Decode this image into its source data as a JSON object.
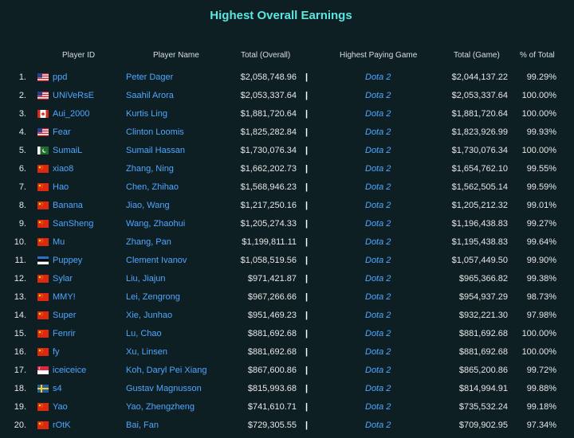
{
  "title": "Highest Overall Earnings",
  "headers": {
    "player_id": "Player ID",
    "player_name": "Player Name",
    "total_overall": "Total (Overall)",
    "highest_paying_game": "Highest Paying Game",
    "total_game": "Total (Game)",
    "pct_total": "% of Total"
  },
  "separator": "|",
  "colors": {
    "background": "#0e1f24",
    "title": "#5ce6e0",
    "link": "#4fa6ff",
    "text": "#e6e6e6"
  },
  "rows": [
    {
      "rank": "1.",
      "flag": "us",
      "id": "ppd",
      "name": "Peter Dager",
      "total": "$2,058,748.96",
      "game": "Dota 2",
      "game_total": "$2,044,137.22",
      "pct": "99.29%"
    },
    {
      "rank": "2.",
      "flag": "us",
      "id": "UNiVeRsE",
      "name": "Saahil Arora",
      "total": "$2,053,337.64",
      "game": "Dota 2",
      "game_total": "$2,053,337.64",
      "pct": "100.00%"
    },
    {
      "rank": "3.",
      "flag": "ca",
      "id": "Aui_2000",
      "name": "Kurtis Ling",
      "total": "$1,881,720.64",
      "game": "Dota 2",
      "game_total": "$1,881,720.64",
      "pct": "100.00%"
    },
    {
      "rank": "4.",
      "flag": "us",
      "id": "Fear",
      "name": "Clinton Loomis",
      "total": "$1,825,282.84",
      "game": "Dota 2",
      "game_total": "$1,823,926.99",
      "pct": "99.93%"
    },
    {
      "rank": "5.",
      "flag": "pk",
      "id": "SumaiL",
      "name": "Sumail Hassan",
      "total": "$1,730,076.34",
      "game": "Dota 2",
      "game_total": "$1,730,076.34",
      "pct": "100.00%"
    },
    {
      "rank": "6.",
      "flag": "cn",
      "id": "xiao8",
      "name": "Zhang, Ning",
      "total": "$1,662,202.73",
      "game": "Dota 2",
      "game_total": "$1,654,762.10",
      "pct": "99.55%"
    },
    {
      "rank": "7.",
      "flag": "cn",
      "id": "Hao",
      "name": "Chen, Zhihao",
      "total": "$1,568,946.23",
      "game": "Dota 2",
      "game_total": "$1,562,505.14",
      "pct": "99.59%"
    },
    {
      "rank": "8.",
      "flag": "cn",
      "id": "Banana",
      "name": "Jiao, Wang",
      "total": "$1,217,250.16",
      "game": "Dota 2",
      "game_total": "$1,205,212.32",
      "pct": "99.01%"
    },
    {
      "rank": "9.",
      "flag": "cn",
      "id": "SanSheng",
      "name": "Wang, Zhaohui",
      "total": "$1,205,274.33",
      "game": "Dota 2",
      "game_total": "$1,196,438.83",
      "pct": "99.27%"
    },
    {
      "rank": "10.",
      "flag": "cn",
      "id": "Mu",
      "name": "Zhang, Pan",
      "total": "$1,199,811.11",
      "game": "Dota 2",
      "game_total": "$1,195,438.83",
      "pct": "99.64%"
    },
    {
      "rank": "11.",
      "flag": "ee",
      "id": "Puppey",
      "name": "Clement Ivanov",
      "total": "$1,058,519.56",
      "game": "Dota 2",
      "game_total": "$1,057,449.50",
      "pct": "99.90%"
    },
    {
      "rank": "12.",
      "flag": "cn",
      "id": "Sylar",
      "name": "Liu, Jiajun",
      "total": "$971,421.87",
      "game": "Dota 2",
      "game_total": "$965,366.82",
      "pct": "99.38%"
    },
    {
      "rank": "13.",
      "flag": "cn",
      "id": "MMY!",
      "name": "Lei, Zengrong",
      "total": "$967,266.66",
      "game": "Dota 2",
      "game_total": "$954,937.29",
      "pct": "98.73%"
    },
    {
      "rank": "14.",
      "flag": "cn",
      "id": "Super",
      "name": "Xie, Junhao",
      "total": "$951,469.23",
      "game": "Dota 2",
      "game_total": "$932,221.30",
      "pct": "97.98%"
    },
    {
      "rank": "15.",
      "flag": "cn",
      "id": "Fenrir",
      "name": "Lu, Chao",
      "total": "$881,692.68",
      "game": "Dota 2",
      "game_total": "$881,692.68",
      "pct": "100.00%"
    },
    {
      "rank": "16.",
      "flag": "cn",
      "id": "fy",
      "name": "Xu, Linsen",
      "total": "$881,692.68",
      "game": "Dota 2",
      "game_total": "$881,692.68",
      "pct": "100.00%"
    },
    {
      "rank": "17.",
      "flag": "sg",
      "id": "iceiceice",
      "name": "Koh, Daryl Pei Xiang",
      "total": "$867,600.86",
      "game": "Dota 2",
      "game_total": "$865,200.86",
      "pct": "99.72%"
    },
    {
      "rank": "18.",
      "flag": "se",
      "id": "s4",
      "name": "Gustav Magnusson",
      "total": "$815,993.68",
      "game": "Dota 2",
      "game_total": "$814,994.91",
      "pct": "99.88%"
    },
    {
      "rank": "19.",
      "flag": "cn",
      "id": "Yao",
      "name": "Yao, Zhengzheng",
      "total": "$741,610.71",
      "game": "Dota 2",
      "game_total": "$735,532.24",
      "pct": "99.18%"
    },
    {
      "rank": "20.",
      "flag": "cn",
      "id": "rOtK",
      "name": "Bai, Fan",
      "total": "$729,305.55",
      "game": "Dota 2",
      "game_total": "$709,902.95",
      "pct": "97.34%"
    }
  ]
}
